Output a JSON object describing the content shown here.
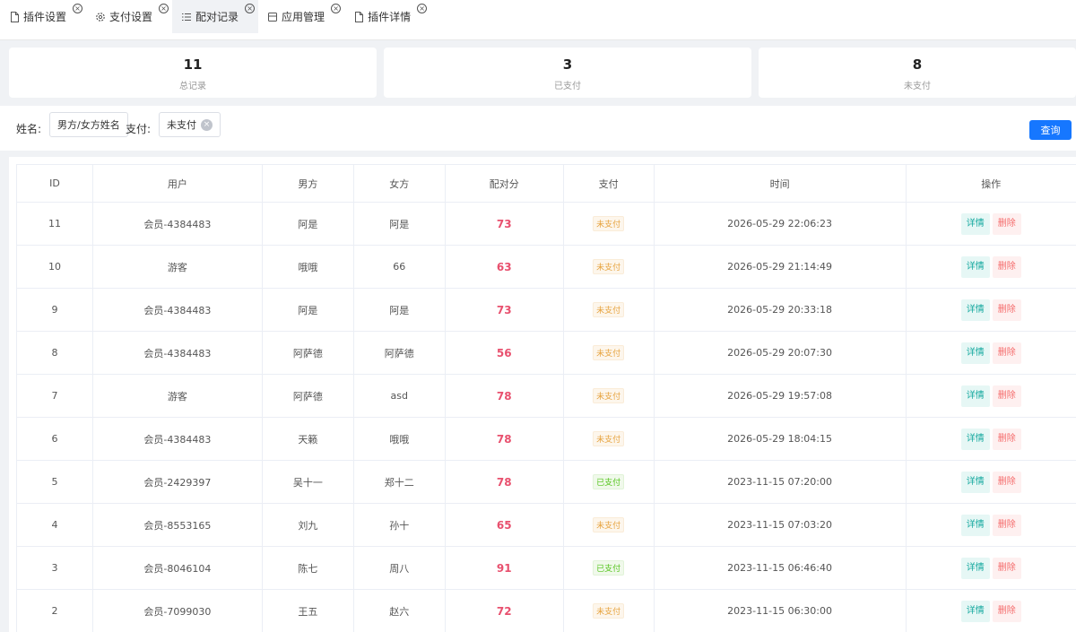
{
  "tabs": [
    {
      "label": "插件设置",
      "icon": "file-icon",
      "active": false
    },
    {
      "label": "支付设置",
      "icon": "gear-icon",
      "active": false
    },
    {
      "label": "配对记录",
      "icon": "list-icon",
      "active": true
    },
    {
      "label": "应用管理",
      "icon": "app-icon",
      "active": false
    },
    {
      "label": "插件详情",
      "icon": "file-icon",
      "active": false
    }
  ],
  "stats": [
    {
      "value": "11",
      "label": "总记录"
    },
    {
      "value": "3",
      "label": "已支付"
    },
    {
      "value": "8",
      "label": "未支付"
    }
  ],
  "filter": {
    "name_label": "姓名:",
    "name_placeholder": "男方/女方姓名",
    "pay_label": "支付:",
    "pay_value": "未支付",
    "query_label": "查询"
  },
  "table": {
    "headers": [
      "ID",
      "用户",
      "男方",
      "女方",
      "配对分",
      "支付",
      "时间",
      "操作"
    ],
    "detail_label": "详情",
    "delete_label": "删除",
    "colors": {
      "score": "#e8506e",
      "paid": "#52c41a",
      "unpaid": "#e6a23c"
    },
    "rows": [
      {
        "id": "11",
        "user": "会员-4384483",
        "male": "阿是",
        "female": "阿是",
        "score": "73",
        "pay": "未支付",
        "paid": false,
        "time": "2026-05-29 22:06:23"
      },
      {
        "id": "10",
        "user": "游客",
        "male": "哦哦",
        "female": "66",
        "score": "63",
        "pay": "未支付",
        "paid": false,
        "time": "2026-05-29 21:14:49"
      },
      {
        "id": "9",
        "user": "会员-4384483",
        "male": "阿是",
        "female": "阿是",
        "score": "73",
        "pay": "未支付",
        "paid": false,
        "time": "2026-05-29 20:33:18"
      },
      {
        "id": "8",
        "user": "会员-4384483",
        "male": "阿萨德",
        "female": "阿萨德",
        "score": "56",
        "pay": "未支付",
        "paid": false,
        "time": "2026-05-29 20:07:30"
      },
      {
        "id": "7",
        "user": "游客",
        "male": "阿萨德",
        "female": "asd",
        "score": "78",
        "pay": "未支付",
        "paid": false,
        "time": "2026-05-29 19:57:08"
      },
      {
        "id": "6",
        "user": "会员-4384483",
        "male": "天籁",
        "female": "哦哦",
        "score": "78",
        "pay": "未支付",
        "paid": false,
        "time": "2026-05-29 18:04:15"
      },
      {
        "id": "5",
        "user": "会员-2429397",
        "male": "吴十一",
        "female": "郑十二",
        "score": "78",
        "pay": "已支付",
        "paid": true,
        "time": "2023-11-15 07:20:00"
      },
      {
        "id": "4",
        "user": "会员-8553165",
        "male": "刘九",
        "female": "孙十",
        "score": "65",
        "pay": "未支付",
        "paid": false,
        "time": "2023-11-15 07:03:20"
      },
      {
        "id": "3",
        "user": "会员-8046104",
        "male": "陈七",
        "female": "周八",
        "score": "91",
        "pay": "已支付",
        "paid": true,
        "time": "2023-11-15 06:46:40"
      },
      {
        "id": "2",
        "user": "会员-7099030",
        "male": "王五",
        "female": "赵六",
        "score": "72",
        "pay": "未支付",
        "paid": false,
        "time": "2023-11-15 06:30:00"
      }
    ]
  }
}
